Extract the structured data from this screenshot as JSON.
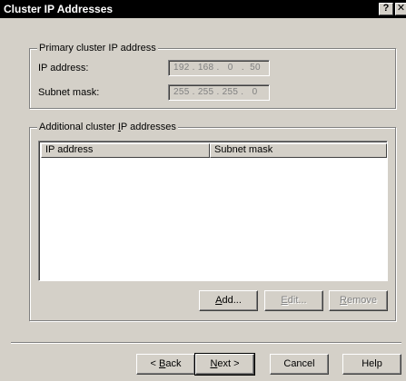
{
  "window": {
    "title": "Cluster IP Addresses",
    "help_glyph": "?",
    "close_glyph": "✕"
  },
  "primary": {
    "group_label": "Primary cluster IP address",
    "ip_label": "IP address:",
    "ip_value": "192 . 168 .   0   .  50",
    "subnet_label": "Subnet mask:",
    "subnet_value": "255 . 255 . 255 .   0"
  },
  "additional": {
    "group_label_pre": "Additional cluster ",
    "group_label_key": "I",
    "group_label_post": "P addresses",
    "columns": [
      "IP address",
      "Subnet mask"
    ],
    "rows": []
  },
  "list_buttons": {
    "add": {
      "key": "A",
      "rest": "dd..."
    },
    "edit": {
      "key": "E",
      "rest": "dit..."
    },
    "remove": {
      "key": "R",
      "rest": "emove"
    }
  },
  "nav_buttons": {
    "back": {
      "prefix": "< ",
      "key": "B",
      "rest": "ack"
    },
    "next": {
      "key": "N",
      "rest": "ext >"
    },
    "cancel": "Cancel",
    "help": "Help"
  }
}
